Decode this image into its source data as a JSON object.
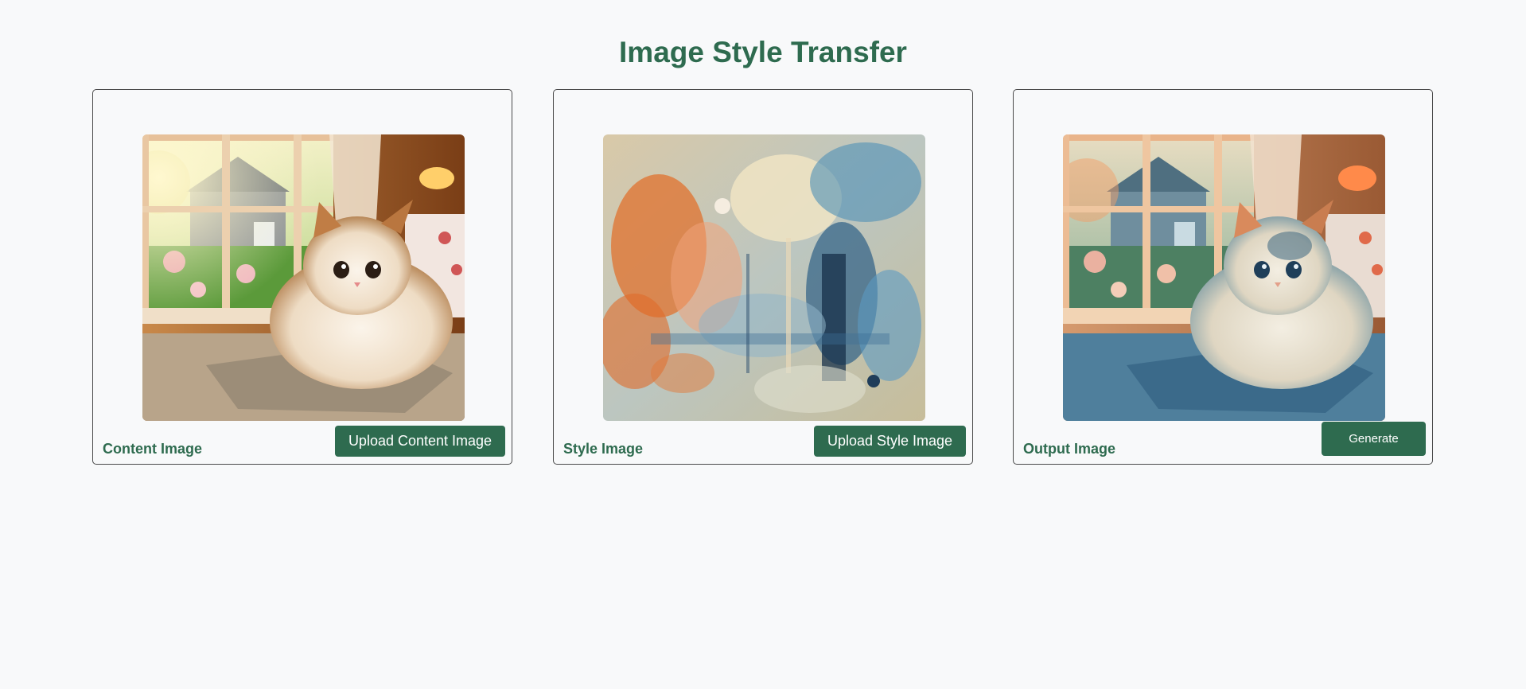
{
  "page": {
    "title": "Image Style Transfer"
  },
  "panels": {
    "content": {
      "label": "Content Image",
      "button_label": "Upload Content Image",
      "image_alt": "cat sitting by window"
    },
    "style": {
      "label": "Style Image",
      "button_label": "Upload Style Image",
      "image_alt": "abstract painting"
    },
    "output": {
      "label": "Output Image",
      "button_label": "Generate",
      "image_alt": "stylized cat by window"
    }
  },
  "colors": {
    "accent": "#2e6b4f",
    "background": "#f8f9fa",
    "panel_border": "#4a4a4a"
  }
}
